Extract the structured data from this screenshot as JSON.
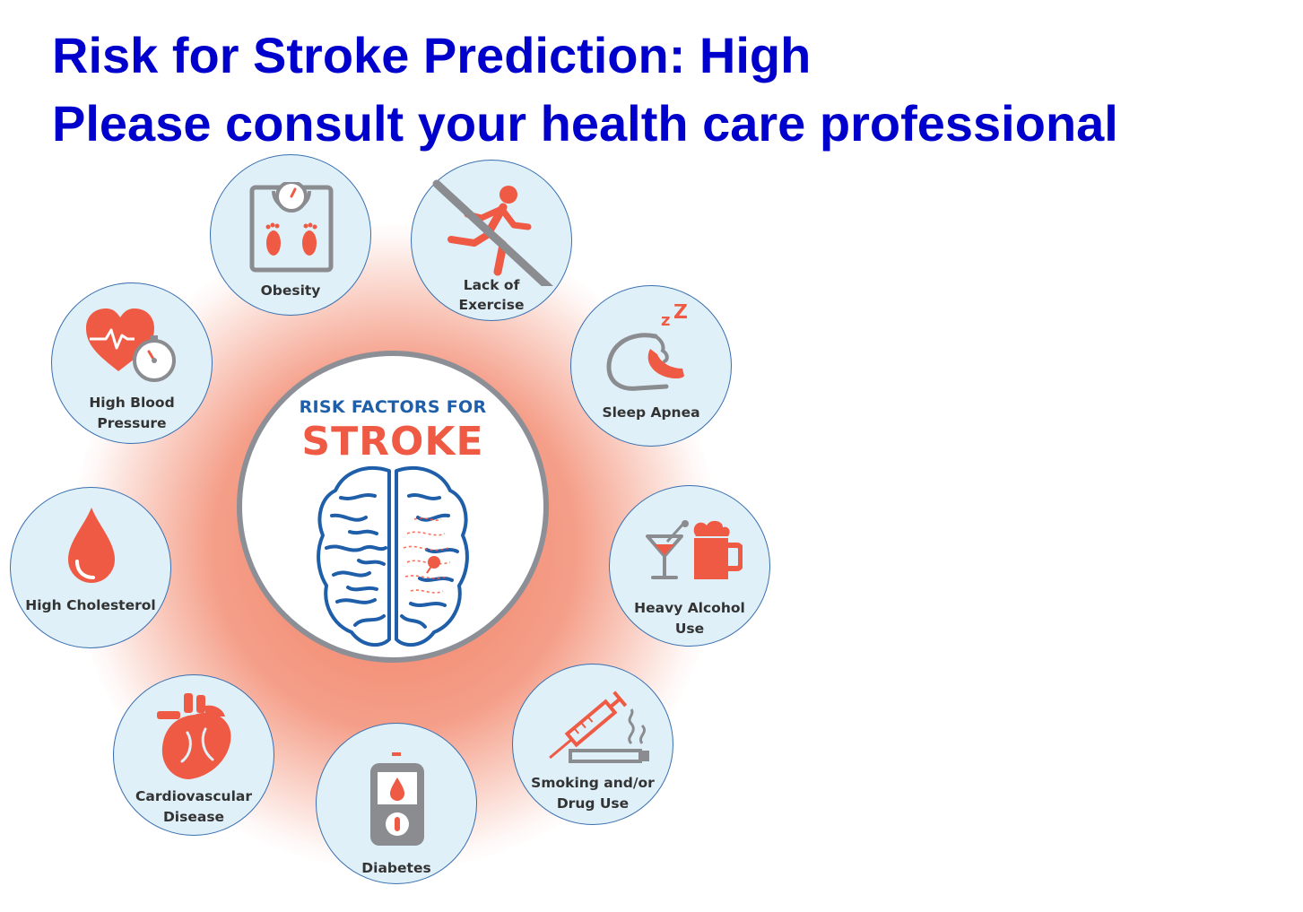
{
  "headline": {
    "line1": "Risk for Stroke Prediction: High",
    "line2": "Please consult your health care professional"
  },
  "center": {
    "title": "RISK FACTORS FOR",
    "subtitle": "STROKE",
    "icon": "brain-icon"
  },
  "factors": {
    "obesity": {
      "label": "Obesity",
      "icon": "scale-icon"
    },
    "exercise": {
      "line1": "Lack of",
      "line2": "Exercise",
      "icon": "no-running-icon"
    },
    "sleep": {
      "label": "Sleep Apnea",
      "icon": "sleeping-head-icon"
    },
    "alcohol": {
      "line1": "Heavy Alcohol",
      "line2": "Use",
      "icon": "drinks-icon"
    },
    "smoking": {
      "line1": "Smoking and/or",
      "line2": "Drug Use",
      "icon": "syringe-cigarette-icon"
    },
    "diabetes": {
      "label": "Diabetes",
      "icon": "glucose-meter-icon"
    },
    "cardio": {
      "line1": "Cardiovascular",
      "line2": "Disease",
      "icon": "heart-icon"
    },
    "cholesterol": {
      "label": "High Cholesterol",
      "icon": "drop-icon"
    },
    "bp": {
      "line1": "High Blood",
      "line2": "Pressure",
      "icon": "heart-gauge-icon"
    }
  },
  "colors": {
    "headline": "#0000cc",
    "accent_red": "#ef5a45",
    "brain_blue": "#1f5ea8",
    "icon_gray": "#8a8c90",
    "circle_fill": "#dff0f8"
  }
}
